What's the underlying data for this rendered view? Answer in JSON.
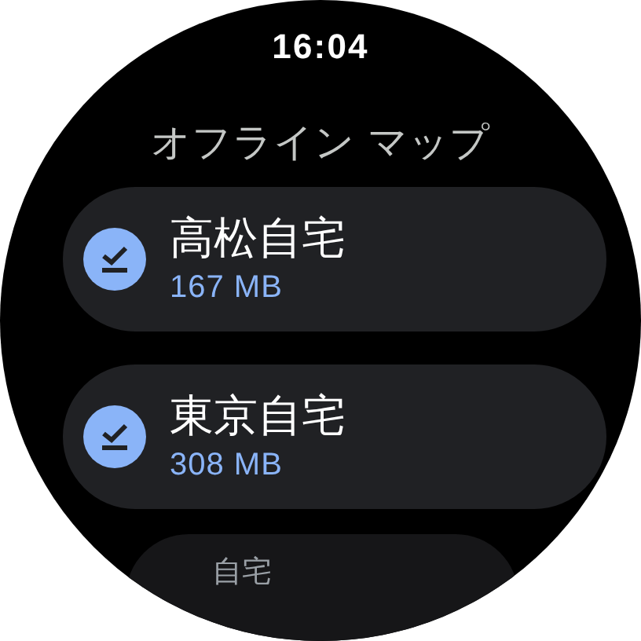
{
  "status_bar": {
    "time": "16:04"
  },
  "title": "オフライン マップ",
  "maps": [
    {
      "kind": "full",
      "name": "高松自宅",
      "size": "167 MB"
    },
    {
      "kind": "full",
      "name": "東京自宅",
      "size": "308 MB"
    },
    {
      "kind": "faded",
      "name": "自宅"
    }
  ]
}
